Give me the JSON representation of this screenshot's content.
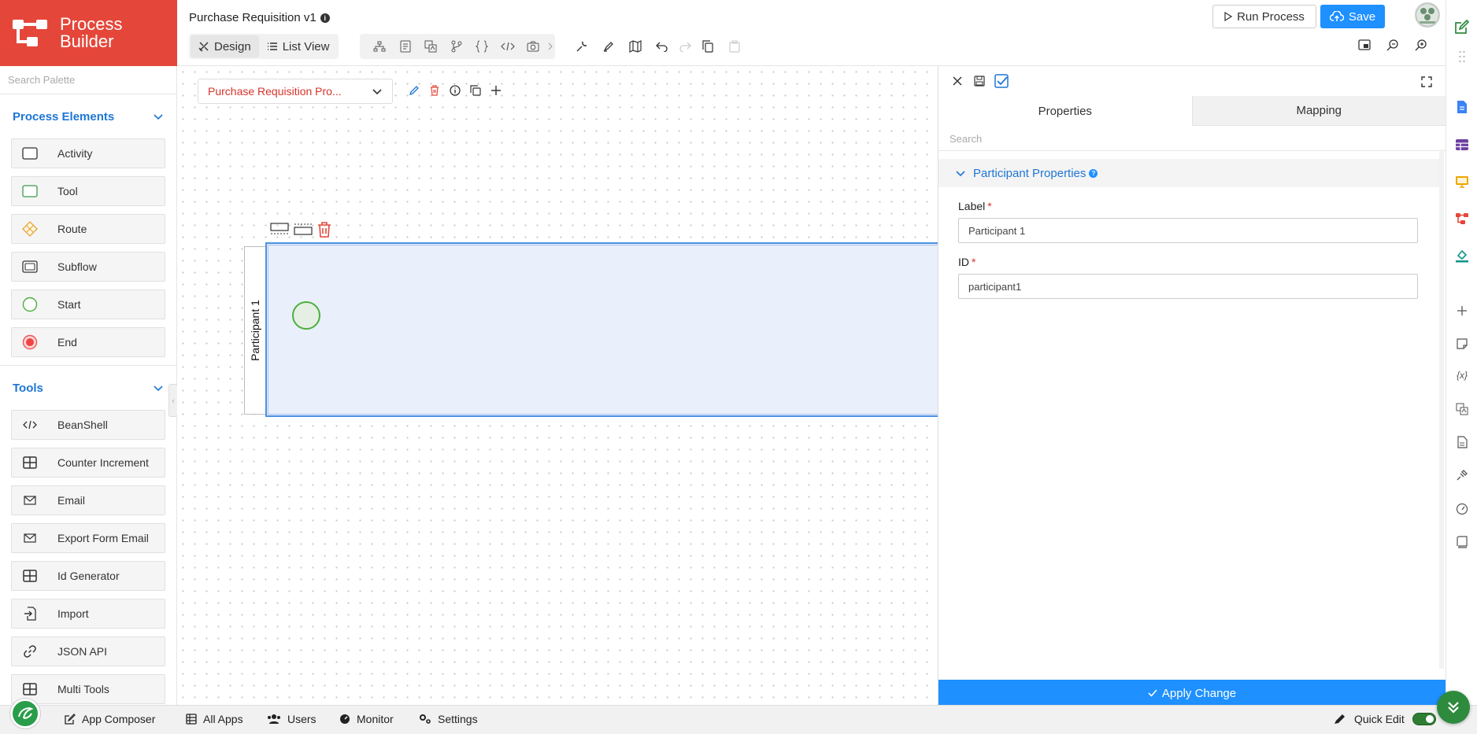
{
  "brand": {
    "title": "Process\nBuilder",
    "color": "#e4473a"
  },
  "palette": {
    "search_placeholder": "Search Palette",
    "process_elements": {
      "title": "Process Elements",
      "items": [
        {
          "label": "Activity",
          "icon": "activity-icon"
        },
        {
          "label": "Tool",
          "icon": "tool-icon"
        },
        {
          "label": "Route",
          "icon": "route-icon"
        },
        {
          "label": "Subflow",
          "icon": "subflow-icon"
        },
        {
          "label": "Start",
          "icon": "start-icon"
        },
        {
          "label": "End",
          "icon": "end-icon"
        }
      ]
    },
    "tools": {
      "title": "Tools",
      "items": [
        {
          "label": "BeanShell",
          "icon": "code-icon"
        },
        {
          "label": "Counter Increment",
          "icon": "table-icon"
        },
        {
          "label": "Email",
          "icon": "mail-icon"
        },
        {
          "label": "Export Form Email",
          "icon": "mail-icon"
        },
        {
          "label": "Id Generator",
          "icon": "table-icon"
        },
        {
          "label": "Import",
          "icon": "import-icon"
        },
        {
          "label": "JSON API",
          "icon": "link-icon"
        },
        {
          "label": "Multi Tools",
          "icon": "table-icon"
        }
      ]
    }
  },
  "header": {
    "title": "Purchase Requisition v1",
    "view_tabs": [
      {
        "label": "Design",
        "icon": "design-icon",
        "active": true
      },
      {
        "label": "List View",
        "icon": "list-icon",
        "active": false
      }
    ],
    "run_label": "Run Process",
    "save_label": "Save",
    "accent": "#1e90ff"
  },
  "canvas": {
    "process_select": "Purchase Requisition Pro...",
    "participant_label": "Participant 1"
  },
  "properties": {
    "tabs": [
      {
        "label": "Properties",
        "active": true
      },
      {
        "label": "Mapping",
        "active": false
      }
    ],
    "search_placeholder": "Search",
    "section_title": "Participant Properties",
    "fields": [
      {
        "label": "Label",
        "required": true,
        "value": "Participant 1"
      },
      {
        "label": "ID",
        "required": true,
        "value": "participant1"
      }
    ],
    "apply_label": "Apply Change"
  },
  "bottom_nav": {
    "items": [
      {
        "label": "App Composer",
        "icon": "edit-icon"
      },
      {
        "label": "All Apps",
        "icon": "grid-icon"
      },
      {
        "label": "Users",
        "icon": "users-icon"
      },
      {
        "label": "Monitor",
        "icon": "monitor-icon"
      },
      {
        "label": "Settings",
        "icon": "settings-icon"
      }
    ],
    "quick_edit_label": "Quick Edit",
    "quick_edit_on": true
  }
}
